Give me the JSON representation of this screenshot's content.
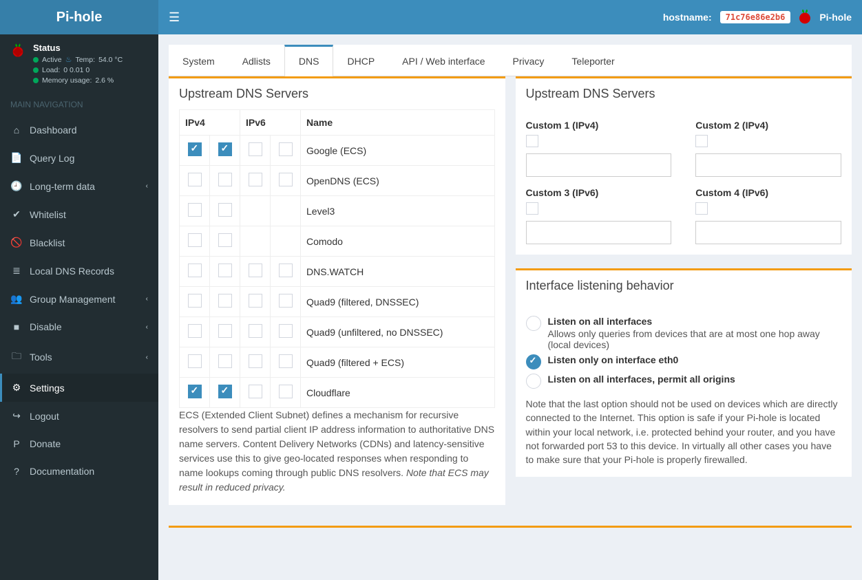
{
  "brand": "Pi-hole",
  "topbar": {
    "hostname_label": "hostname:",
    "hostname_value": "71c76e86e2b6",
    "brand_right": "Pi-hole"
  },
  "status": {
    "title": "Status",
    "active": "Active",
    "temp_label": "Temp:",
    "temp_value": "54.0 °C",
    "load_label": "Load:",
    "load_value": "0  0.01  0",
    "mem_label": "Memory usage:",
    "mem_value": "2.6 %"
  },
  "nav_header": "MAIN NAVIGATION",
  "nav": [
    {
      "icon": "⌂",
      "label": "Dashboard",
      "expand": false
    },
    {
      "icon": "📄",
      "label": "Query Log",
      "expand": false
    },
    {
      "icon": "🕘",
      "label": "Long-term data",
      "expand": true
    },
    {
      "icon": "✔",
      "label": "Whitelist",
      "expand": false
    },
    {
      "icon": "🚫",
      "label": "Blacklist",
      "expand": false
    },
    {
      "icon": "≣",
      "label": "Local DNS Records",
      "expand": false
    },
    {
      "icon": "👥",
      "label": "Group Management",
      "expand": true
    },
    {
      "icon": "■",
      "label": "Disable",
      "expand": true
    },
    {
      "icon": "🗀",
      "label": "Tools",
      "expand": true
    },
    {
      "icon": "⚙",
      "label": "Settings",
      "expand": false,
      "active": true
    },
    {
      "icon": "↪",
      "label": "Logout",
      "expand": false
    },
    {
      "icon": "P",
      "label": "Donate",
      "expand": false
    },
    {
      "icon": "?",
      "label": "Documentation",
      "expand": false
    }
  ],
  "tabs": [
    "System",
    "Adlists",
    "DNS",
    "DHCP",
    "API / Web interface",
    "Privacy",
    "Teleporter"
  ],
  "active_tab": "DNS",
  "upstream_title": "Upstream DNS Servers",
  "dns_headers": {
    "ipv4": "IPv4",
    "ipv6": "IPv6",
    "name": "Name"
  },
  "dns_rows": [
    {
      "v4a": true,
      "v4b": true,
      "v6a": false,
      "v6b": false,
      "has_v6": true,
      "name": "Google (ECS)"
    },
    {
      "v4a": false,
      "v4b": false,
      "v6a": false,
      "v6b": false,
      "has_v6": true,
      "name": "OpenDNS (ECS)"
    },
    {
      "v4a": false,
      "v4b": false,
      "v6a": false,
      "v6b": false,
      "has_v6": false,
      "name": "Level3"
    },
    {
      "v4a": false,
      "v4b": false,
      "v6a": false,
      "v6b": false,
      "has_v6": false,
      "name": "Comodo"
    },
    {
      "v4a": false,
      "v4b": false,
      "v6a": false,
      "v6b": false,
      "has_v6": true,
      "name": "DNS.WATCH"
    },
    {
      "v4a": false,
      "v4b": false,
      "v6a": false,
      "v6b": false,
      "has_v6": true,
      "name": "Quad9 (filtered, DNSSEC)"
    },
    {
      "v4a": false,
      "v4b": false,
      "v6a": false,
      "v6b": false,
      "has_v6": true,
      "name": "Quad9 (unfiltered, no DNSSEC)"
    },
    {
      "v4a": false,
      "v4b": false,
      "v6a": false,
      "v6b": false,
      "has_v6": true,
      "name": "Quad9 (filtered + ECS)"
    },
    {
      "v4a": true,
      "v4b": true,
      "v6a": false,
      "v6b": false,
      "has_v6": true,
      "name": "Cloudflare"
    }
  ],
  "ecs_text": "ECS (Extended Client Subnet) defines a mechanism for recursive resolvers to send partial client IP address information to authoritative DNS name servers. Content Delivery Networks (CDNs) and latency-sensitive services use this to give geo-located responses when responding to name lookups coming through public DNS resolvers. ",
  "ecs_italic": "Note that ECS may result in reduced privacy.",
  "custom_title": "Upstream DNS Servers",
  "custom": [
    {
      "label": "Custom 1 (IPv4)"
    },
    {
      "label": "Custom 2 (IPv4)"
    },
    {
      "label": "Custom 3 (IPv6)"
    },
    {
      "label": "Custom 4 (IPv6)"
    }
  ],
  "interface_title": "Interface listening behavior",
  "interface_opts": [
    {
      "label": "Listen on all interfaces",
      "desc": "Allows only queries from devices that are at most one hop away (local devices)",
      "checked": false
    },
    {
      "label": "Listen only on interface eth0",
      "desc": "",
      "checked": true
    },
    {
      "label": "Listen on all interfaces, permit all origins",
      "desc": "",
      "checked": false
    }
  ],
  "interface_note": "Note that the last option should not be used on devices which are directly connected to the Internet. This option is safe if your Pi-hole is located within your local network, i.e. protected behind your router, and you have not forwarded port 53 to this device. In virtually all other cases you have to make sure that your Pi-hole is properly firewalled."
}
